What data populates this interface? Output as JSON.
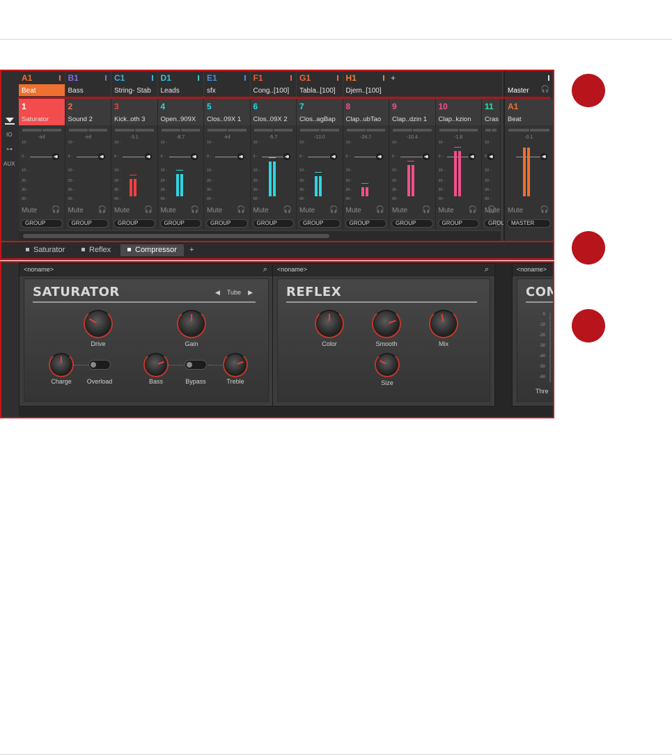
{
  "groups": [
    {
      "code": "A1",
      "name": "Beat",
      "color": "#f07030",
      "selected": true
    },
    {
      "code": "B1",
      "name": "Bass",
      "color": "#8a6ae0",
      "selected": false
    },
    {
      "code": "C1",
      "name": "String- Stab",
      "color": "#3ab4e8",
      "selected": false
    },
    {
      "code": "D1",
      "name": "Leads",
      "color": "#30c6e0",
      "selected": false
    },
    {
      "code": "E1",
      "name": "sfx",
      "color": "#4a90e0",
      "selected": false
    },
    {
      "code": "F1",
      "name": "Cong..[100]",
      "color": "#f05a3a",
      "selected": false
    },
    {
      "code": "G1",
      "name": "Tabla..[100]",
      "color": "#f06a3a",
      "selected": false
    },
    {
      "code": "H1",
      "name": "Djem..[100]",
      "color": "#f0803a",
      "selected": false
    }
  ],
  "add_group": "+",
  "master": {
    "label": "Master",
    "headphones": "🎧",
    "channel_code": "A1",
    "channel_name": "Beat",
    "volume": "-0.1",
    "button": "MASTER"
  },
  "side": {
    "io": "IO",
    "aux": "AUX"
  },
  "channels": [
    {
      "num": "1",
      "name": "Saturator",
      "color": "#ffffff",
      "volume": "-inf",
      "meter": 0,
      "meter_color": "#f24c4c",
      "selected": true
    },
    {
      "num": "2",
      "name": "Sound 2",
      "color": "#f07050",
      "volume": "-inf",
      "meter": 0,
      "meter_color": "#f24c4c",
      "selected": false
    },
    {
      "num": "3",
      "name": "Kick..oth 3",
      "color": "#f04040",
      "volume": "-3.1",
      "meter": 0.35,
      "meter_color": "#f04040",
      "selected": false
    },
    {
      "num": "4",
      "name": "Open..909X",
      "color": "#30d4e0",
      "volume": "-8.7",
      "meter": 0.45,
      "meter_color": "#30d4e0",
      "selected": false
    },
    {
      "num": "5",
      "name": "Clos..09X 1",
      "color": "#30d4e0",
      "volume": "-inf",
      "meter": 0,
      "meter_color": "#30d4e0",
      "selected": false
    },
    {
      "num": "6",
      "name": "Clos..09X 2",
      "color": "#30d4e0",
      "volume": "-5.7",
      "meter": 0.7,
      "meter_color": "#30d4e0",
      "selected": false
    },
    {
      "num": "7",
      "name": "Clos..agBap",
      "color": "#30d4e0",
      "volume": "-13.0",
      "meter": 0.4,
      "meter_color": "#30d4e0",
      "selected": false
    },
    {
      "num": "8",
      "name": "Clap..ubTao",
      "color": "#f0508a",
      "volume": "-24.7",
      "meter": 0.18,
      "meter_color": "#f0508a",
      "selected": false
    },
    {
      "num": "9",
      "name": "Clap..dzin 1",
      "color": "#f0508a",
      "volume": "-10.4",
      "meter": 0.62,
      "meter_color": "#f0508a",
      "selected": false
    },
    {
      "num": "10",
      "name": "Clap..kzion",
      "color": "#f0508a",
      "volume": "-1.8",
      "meter": 0.9,
      "meter_color": "#f0508a",
      "selected": false
    },
    {
      "num": "11",
      "name": "Cras",
      "color": "#30e0a0",
      "volume": "",
      "meter": 0,
      "meter_color": "#30e0a0",
      "selected": false
    }
  ],
  "mute_label": "Mute",
  "group_button": "GROUP",
  "ticks": [
    "10 -",
    "0 -",
    "10 -",
    "20 -",
    "30 -",
    "00 -"
  ],
  "tabs": [
    {
      "label": "Saturator",
      "selected": false
    },
    {
      "label": "Reflex",
      "selected": false
    },
    {
      "label": "Compressor",
      "selected": true
    }
  ],
  "add_tab": "+",
  "plugins": {
    "saturator": {
      "preset": "<noname>",
      "title": "SATURATOR",
      "mode": "Tube",
      "prev": "◀",
      "next": "▶",
      "knobs": {
        "drive": "Drive",
        "gain": "Gain",
        "charge": "Charge",
        "bass": "Bass",
        "treble": "Treble"
      },
      "toggles": {
        "overload": "Overload",
        "bypass": "Bypass"
      }
    },
    "reflex": {
      "preset": "<noname>",
      "title": "REFLEX",
      "knobs": {
        "color": "Color",
        "smooth": "Smooth",
        "mix": "Mix",
        "size": "Size"
      }
    },
    "compressor": {
      "preset": "<noname>",
      "title": "COM",
      "thresh": "Thre",
      "scale": [
        "0",
        "-10",
        "-20",
        "-30",
        "-40",
        "-50",
        "-60"
      ]
    }
  },
  "callouts": [
    "",
    "",
    ""
  ]
}
